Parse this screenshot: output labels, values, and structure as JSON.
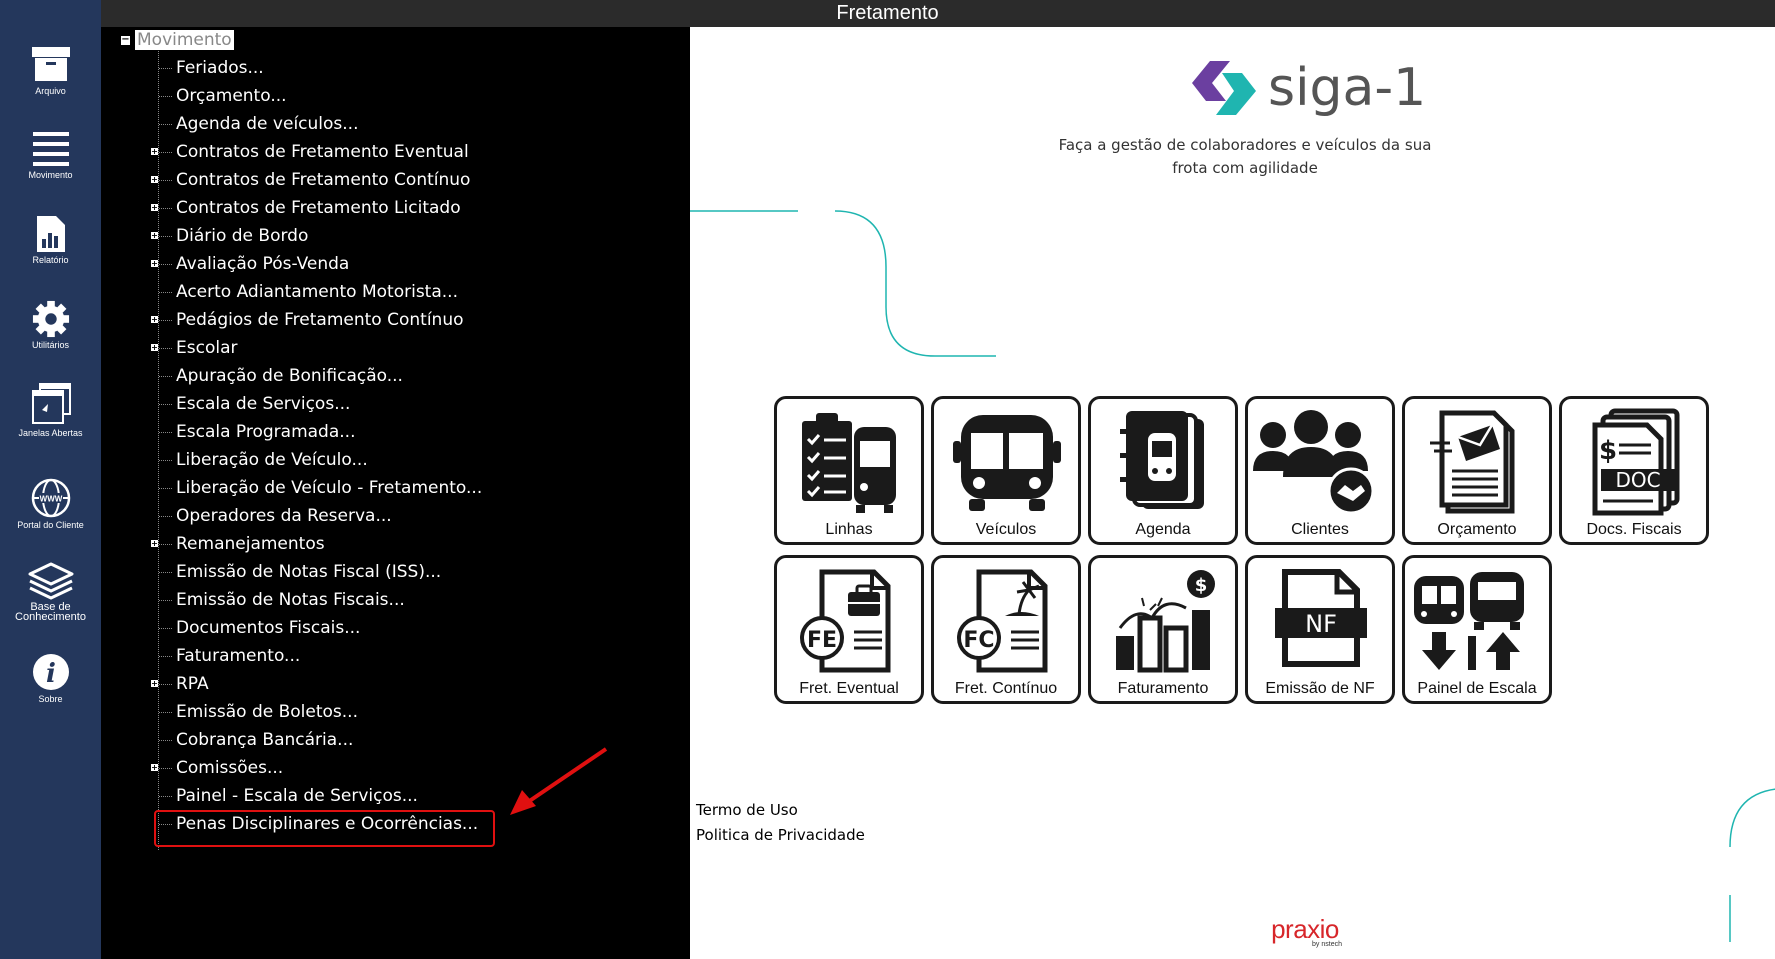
{
  "window": {
    "title": "Fretamento"
  },
  "sidebar": {
    "items": [
      {
        "label": "Arquivo",
        "icon": "archive-icon"
      },
      {
        "label": "Movimento",
        "icon": "menu-icon"
      },
      {
        "label": "Relatório",
        "icon": "report-icon"
      },
      {
        "label": "Utilitários",
        "icon": "gear-icon"
      },
      {
        "label": "Janelas Abertas",
        "icon": "windows-icon"
      },
      {
        "label": "Portal do Cliente",
        "icon": "globe-icon"
      },
      {
        "label": "Base de",
        "label2": "Conhecimento",
        "icon": "layers-icon"
      },
      {
        "label": "Sobre",
        "icon": "info-icon"
      }
    ]
  },
  "tree": {
    "root": "Movimento",
    "items": [
      {
        "label": "Feriados...",
        "expandable": false
      },
      {
        "label": "Orçamento...",
        "expandable": false
      },
      {
        "label": "Agenda de veículos...",
        "expandable": false
      },
      {
        "label": "Contratos de Fretamento Eventual",
        "expandable": true
      },
      {
        "label": "Contratos de Fretamento Contínuo",
        "expandable": true
      },
      {
        "label": "Contratos de Fretamento Licitado",
        "expandable": true
      },
      {
        "label": "Diário de Bordo",
        "expandable": true
      },
      {
        "label": "Avaliação Pós-Venda",
        "expandable": true
      },
      {
        "label": "Acerto Adiantamento Motorista...",
        "expandable": false
      },
      {
        "label": "Pedágios de Fretamento Contínuo",
        "expandable": true
      },
      {
        "label": "Escolar",
        "expandable": true
      },
      {
        "label": "Apuração de Bonificação...",
        "expandable": false
      },
      {
        "label": "Escala de Serviços...",
        "expandable": false
      },
      {
        "label": "Escala Programada...",
        "expandable": false
      },
      {
        "label": "Liberação de Veículo...",
        "expandable": false
      },
      {
        "label": "Liberação de Veículo - Fretamento...",
        "expandable": false
      },
      {
        "label": "Operadores da Reserva...",
        "expandable": false
      },
      {
        "label": "Remanejamentos",
        "expandable": true
      },
      {
        "label": "Emissão de Notas Fiscal (ISS)...",
        "expandable": false
      },
      {
        "label": "Emissão de Notas Fiscais...",
        "expandable": false
      },
      {
        "label": "Documentos Fiscais...",
        "expandable": false
      },
      {
        "label": "Faturamento...",
        "expandable": false
      },
      {
        "label": "RPA",
        "expandable": true
      },
      {
        "label": "Emissão de Boletos...",
        "expandable": false
      },
      {
        "label": "Cobrança Bancária...",
        "expandable": false
      },
      {
        "label": "Comissões...",
        "expandable": true
      },
      {
        "label": "Painel - Escala de Serviços...",
        "expandable": false
      },
      {
        "label": "Penas Disciplinares e Ocorrências...",
        "expandable": false
      }
    ]
  },
  "brand": {
    "name": "siga-1",
    "tagline_line1": "Faça a gestão de colaboradores e veículos da sua",
    "tagline_line2": "frota com agilidade",
    "footer_logo": "praxio",
    "footer_logo_sub": "by nstech",
    "colors": {
      "purple": "#6b3fa0",
      "teal": "#1fb5b0",
      "logo_text": "#555555",
      "praxio_red": "#d7262a"
    }
  },
  "tiles": [
    {
      "label": "Linhas",
      "icon": "routes-checklist-icon"
    },
    {
      "label": "Veículos",
      "icon": "bus-icon"
    },
    {
      "label": "Agenda",
      "icon": "agenda-bus-icon"
    },
    {
      "label": "Clientes",
      "icon": "clients-icon"
    },
    {
      "label": "Orçamento",
      "icon": "quote-envelope-icon"
    },
    {
      "label": "Docs. Fiscais",
      "icon": "fiscal-doc-icon",
      "badge": "DOC"
    },
    {
      "label": "Fret. Eventual",
      "icon": "eventual-charter-icon",
      "badge": "FE"
    },
    {
      "label": "Fret. Contínuo",
      "icon": "continuous-charter-icon",
      "badge": "FC"
    },
    {
      "label": "Faturamento",
      "icon": "billing-chart-icon"
    },
    {
      "label": "Emissão de NF",
      "icon": "invoice-icon",
      "badge": "NF"
    },
    {
      "label": "Painel de Escala",
      "icon": "schedule-panel-icon"
    }
  ],
  "links": {
    "terms": "Termo de Uso",
    "privacy": "Politica de Privacidade"
  }
}
